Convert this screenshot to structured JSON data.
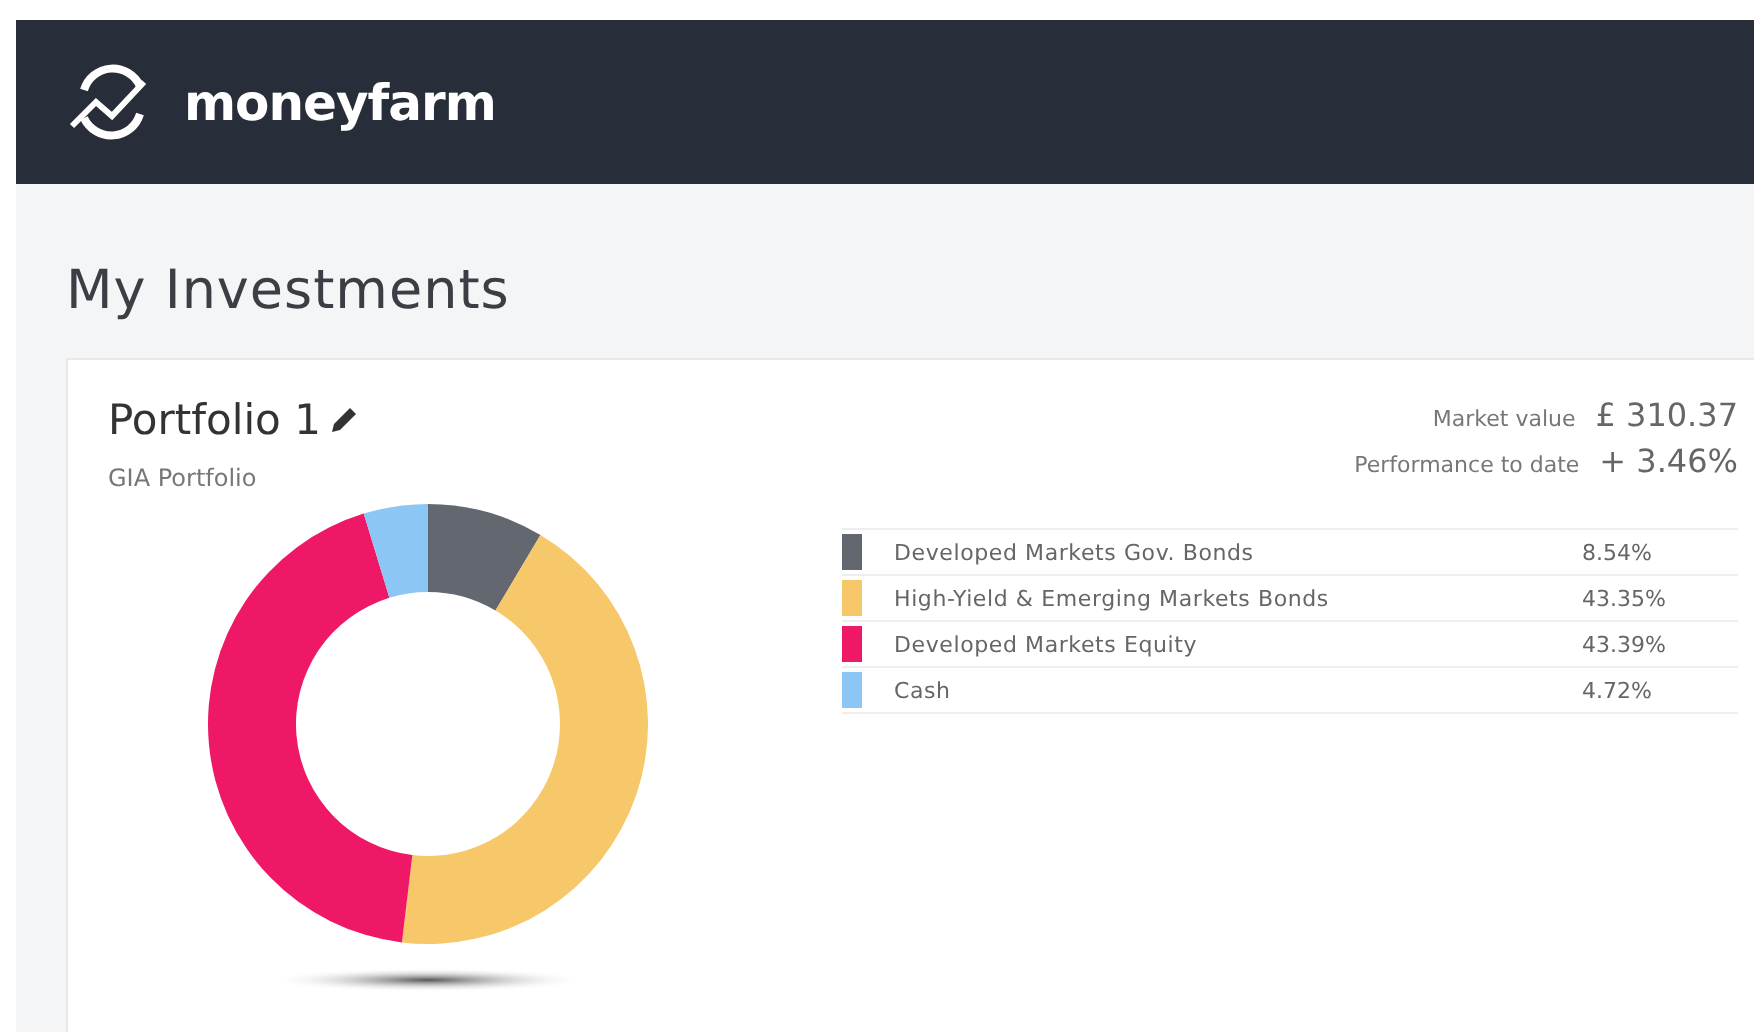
{
  "brand": {
    "name": "moneyfarm"
  },
  "page_title": "My Investments",
  "portfolio": {
    "name": "Portfolio 1",
    "type": "GIA Portfolio",
    "stats": [
      {
        "label": "Market value",
        "value": "£ 310.37"
      },
      {
        "label": "Performance to date",
        "value": "+ 3.46%"
      }
    ],
    "allocation": [
      {
        "label": "Developed Markets Gov. Bonds",
        "percent": "8.54%",
        "color": "#636870"
      },
      {
        "label": "High-Yield & Emerging Markets Bonds",
        "percent": "43.35%",
        "color": "#f7c86a"
      },
      {
        "label": "Developed Markets Equity",
        "percent": "43.39%",
        "color": "#ee1867"
      },
      {
        "label": "Cash",
        "percent": "4.72%",
        "color": "#8cc6f5"
      }
    ],
    "chart_data": {
      "type": "donut",
      "values": [
        8.54,
        43.35,
        43.39,
        4.72
      ]
    }
  }
}
